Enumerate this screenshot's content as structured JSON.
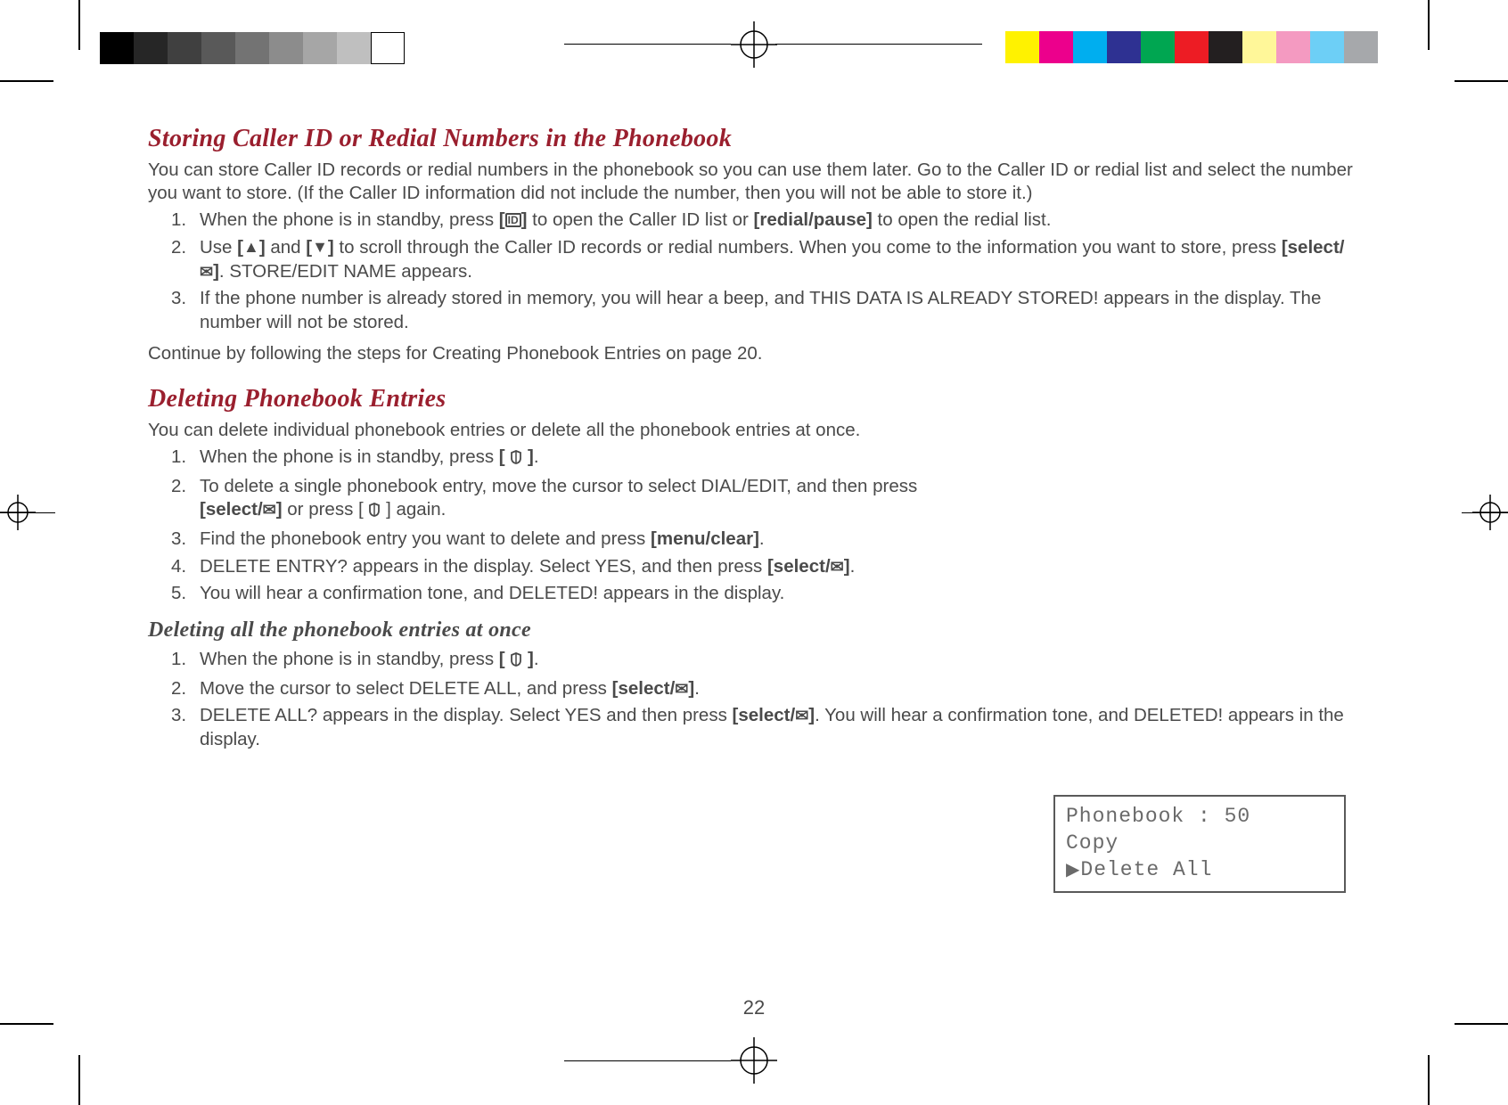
{
  "section1": {
    "heading": "Storing Caller ID or Redial Numbers in the Phonebook",
    "intro": "You can store Caller ID records or redial numbers in the phonebook so you can use them later. Go to the Caller ID or redial list and select the number you want to store. (If the Caller ID information did not include the number, then you will not be able to store it.)",
    "steps": [
      {
        "n": "1.",
        "pre": "When the phone is in standby, press ",
        "k1": "[",
        "k1b": "]",
        "mid": " to open the Caller ID list or ",
        "k2": "[redial/pause]",
        "post": " to open the redial list."
      },
      {
        "n": "2.",
        "pre": "Use ",
        "k1": "[",
        "k1b": "]",
        "mid": " and ",
        "k2": "[",
        "k2b": "]",
        "mid2": "  to scroll through the Caller ID records or redial numbers. When you come to the information you want to store, press ",
        "k3": "[select/",
        "k3b": "]",
        "post2": ". STORE/EDIT NAME appears."
      },
      {
        "n": "3.",
        "text": "If the phone number is already stored in memory, you will hear a beep, and THIS DATA IS ALREADY STORED! appears in the display. The number will not be stored."
      }
    ],
    "outro": "Continue by following the steps for Creating Phonebook Entries on page 20."
  },
  "section2": {
    "heading": "Deleting Phonebook Entries",
    "intro": "You can delete individual phonebook entries or delete all the phonebook entries at once.",
    "steps": [
      {
        "n": "1.",
        "pre": "When the phone is in standby, press ",
        "k1": "[ ",
        "k1b": " ]",
        "post": "."
      },
      {
        "n": "2.",
        "pre": "To delete a single phonebook entry, move the cursor to select DIAL/EDIT, and then press ",
        "k1": "[select/",
        "k1b": "]",
        "mid": " or press [ ",
        "mid2": " ] again."
      },
      {
        "n": "3.",
        "pre": "Find the phonebook entry you want to delete and press ",
        "k1": "[menu/clear]",
        "post": "."
      },
      {
        "n": "4.",
        "pre": "DELETE ENTRY? appears in the display. Select YES, and then press ",
        "k1": "[select/",
        "k1b": "]",
        "post": "."
      },
      {
        "n": "5.",
        "text": "You will hear a confirmation tone, and DELETED! appears in the display."
      }
    ],
    "subheading": "Deleting all the phonebook entries at once",
    "steps2": [
      {
        "n": "1.",
        "pre": "When the phone is in standby, press ",
        "k1": "[ ",
        "k1b": " ]",
        "post": "."
      },
      {
        "n": "2.",
        "pre": "Move the cursor to select DELETE ALL, and press ",
        "k1": "[select/",
        "k1b": "]",
        "post": "."
      },
      {
        "n": "3.",
        "pre": "DELETE ALL? appears in the display. Select YES and then press ",
        "k1": "[select/",
        "k1b": "]",
        "post": ". You will hear a confirmation tone, and DELETED! appears in the display."
      }
    ]
  },
  "lcd": {
    "l1": "Phonebook : 50",
    "l2": " Copy",
    "l3": "Delete All"
  },
  "pagenum": "22",
  "grays": [
    "#000000",
    "#262626",
    "#404040",
    "#595959",
    "#737373",
    "#8c8c8c",
    "#a6a6a6",
    "#bfbfbf",
    "#ffffff"
  ],
  "colors": [
    "#fff200",
    "#ec008c",
    "#00aeef",
    "#2e3192",
    "#00a651",
    "#ed1c24",
    "#231f20",
    "#fff799",
    "#f49ac1",
    "#6dcff6",
    "#a6a8ab"
  ]
}
